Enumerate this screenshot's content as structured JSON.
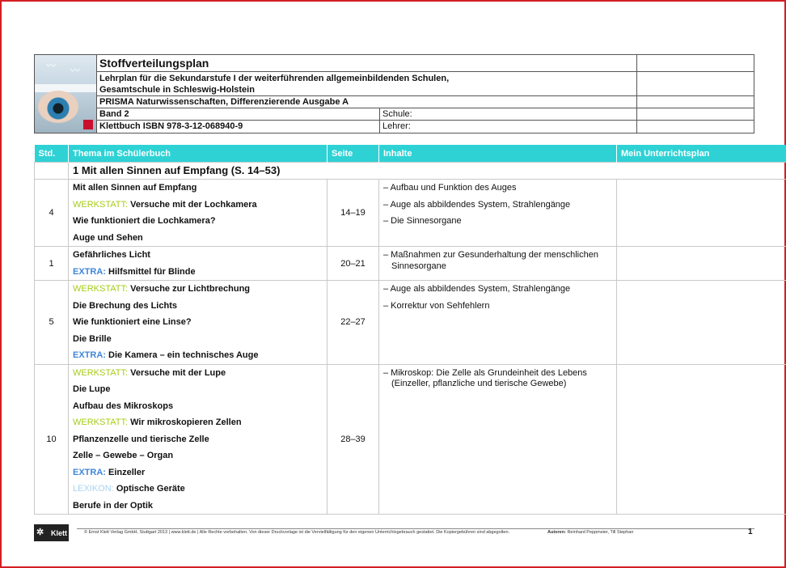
{
  "header": {
    "title": "Stoffverteilungsplan",
    "line1": "Lehrplan für die Sekundarstufe I der weiterführenden allgemeinbildenden Schulen,",
    "line2": "Gesamtschule in Schleswig-Holstein",
    "line3": "PRISMA Naturwissenschaften, Differenzierende Ausgabe A",
    "band": "Band 2",
    "isbn": "Klettbuch ISBN 978-3-12-068940-9",
    "school_label": "Schule:",
    "teacher_label": "Lehrer:"
  },
  "table": {
    "columns": [
      "Std.",
      "Thema im Schülerbuch",
      "Seite",
      "Inhalte",
      "Mein Unterrichtsplan"
    ],
    "chapter": "1 Mit allen Sinnen auf Empfang (S. 14–53)",
    "groups": [
      {
        "std": "4",
        "seite": "14–19",
        "topics": [
          {
            "prefix": "",
            "text": "Mit allen Sinnen auf Empfang"
          },
          {
            "prefix": "WERKSTATT:",
            "type": "werkstatt",
            "text": "Versuche mit der Lochkamera"
          },
          {
            "prefix": "",
            "text": "Wie funktioniert die Lochkamera?"
          },
          {
            "prefix": "",
            "text": "Auge und Sehen"
          }
        ],
        "contents": [
          "– Aufbau und Funktion des Auges",
          "– Auge als abbildendes System, Strahlengänge",
          "– Die Sinnesorgane"
        ]
      },
      {
        "std": "1",
        "seite": "20–21",
        "topics": [
          {
            "prefix": "",
            "text": "Gefährliches Licht"
          },
          {
            "prefix": "EXTRA:",
            "type": "extra",
            "text": "Hilfsmittel für Blinde"
          }
        ],
        "contents": [
          "– Maßnahmen zur Gesunderhaltung der menschlichen Sinnesorgane"
        ]
      },
      {
        "std": "5",
        "seite": "22–27",
        "topics": [
          {
            "prefix": "WERKSTATT:",
            "type": "werkstatt",
            "text": "Versuche zur Lichtbrechung"
          },
          {
            "prefix": "",
            "text": "Die Brechung des Lichts"
          },
          {
            "prefix": "",
            "text": "Wie funktioniert eine Linse?"
          },
          {
            "prefix": "",
            "text": "Die Brille"
          },
          {
            "prefix": "EXTRA:",
            "type": "extra",
            "text": "Die Kamera – ein technisches Auge"
          }
        ],
        "contents": [
          "– Auge als abbildendes System, Strahlengänge",
          "– Korrektur von Sehfehlern"
        ]
      },
      {
        "std": "10",
        "seite": "28–39",
        "topics": [
          {
            "prefix": "WERKSTATT:",
            "type": "werkstatt",
            "text": "Versuche mit der Lupe"
          },
          {
            "prefix": "",
            "text": "Die Lupe"
          },
          {
            "prefix": "",
            "text": "Aufbau des Mikroskops"
          },
          {
            "prefix": "WERKSTATT:",
            "type": "werkstatt",
            "text": "Wir mikroskopieren Zellen"
          },
          {
            "prefix": "",
            "text": "Pflanzenzelle und tierische Zelle"
          },
          {
            "prefix": "",
            "text": "Zelle – Gewebe – Organ"
          },
          {
            "prefix": "EXTRA:",
            "type": "extra",
            "text": "Einzeller"
          },
          {
            "prefix": "LEXIKON:",
            "type": "lexikon",
            "text": "Optische Geräte"
          },
          {
            "prefix": "",
            "text": "Berufe in der Optik"
          }
        ],
        "contents": [
          "– Mikroskop: Die Zelle als Grundeinheit des Lebens (Einzeller, pflanzliche und tierische Gewebe)"
        ]
      }
    ]
  },
  "footer": {
    "logo_text": "Klett",
    "copyright": "© Ernst Klett Verlag GmbH, Stuttgart 2013 | www.klett.de | Alle Rechte vorbehalten. Von dieser Druckvorlage ist die Vervielfältigung für den eigenen Unterrichtsgebrauch gestattet. Die Kopiergebühren sind abgegolten.",
    "authors_label": "Autoren:",
    "authors": "Reinhard Peppmeier, Till Stephan",
    "page": "1"
  },
  "colors": {
    "header_bg": "#2ed2d5",
    "werkstatt": "#a6cc1a",
    "extra": "#3f86d9",
    "lexikon": "#a9d3ef",
    "frame": "#d21e23"
  }
}
